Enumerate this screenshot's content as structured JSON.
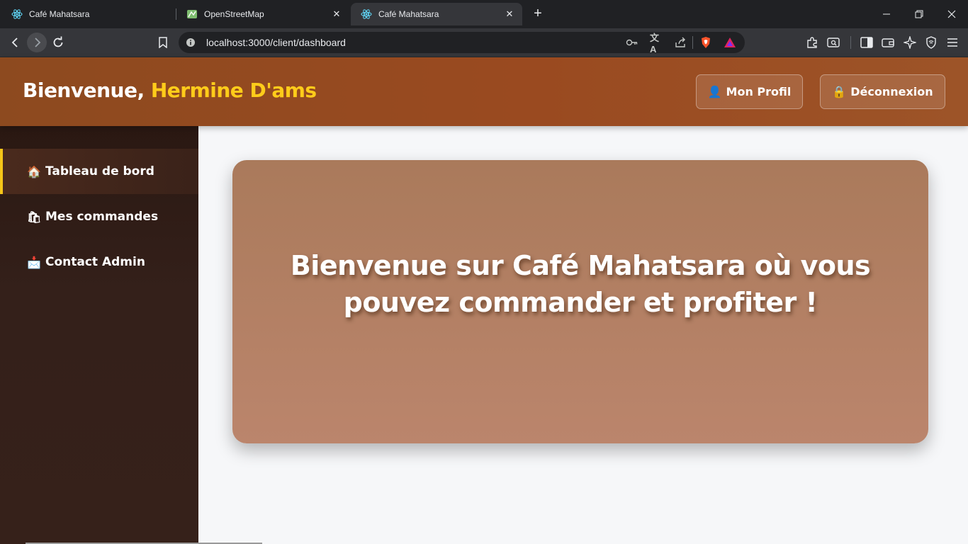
{
  "browser": {
    "tabs": [
      {
        "title": "Café Mahatsara",
        "icon": "react-icon",
        "active": false
      },
      {
        "title": "OpenStreetMap",
        "icon": "map-icon",
        "active": false
      },
      {
        "title": "Café Mahatsara",
        "icon": "react-icon",
        "active": true
      }
    ],
    "url": "localhost:3000/client/dashboard"
  },
  "header": {
    "greeting": "Bienvenue,",
    "username": "Hermine D'ams",
    "profile_button": {
      "emoji": "👤",
      "label": "Mon Profil"
    },
    "logout_button": {
      "emoji": "🔒",
      "label": "Déconnexion"
    }
  },
  "sidebar": {
    "items": [
      {
        "emoji": "🏠",
        "label": "Tableau de bord",
        "active": true
      },
      {
        "emoji": "🛍",
        "label": "Mes commandes",
        "active": false
      },
      {
        "emoji": "📩",
        "label": "Contact Admin",
        "active": false
      }
    ]
  },
  "main": {
    "hero_text": "Bienvenue sur Café Mahatsara où vous pouvez commander et profiter !"
  },
  "colors": {
    "header_bg": "#9a4a20",
    "username_accent": "#ffcc1a",
    "sidebar_bg": "#34201a",
    "active_indicator": "#f5c518",
    "hero_bg": "#b37f63",
    "page_bg": "#f6f7f9"
  }
}
